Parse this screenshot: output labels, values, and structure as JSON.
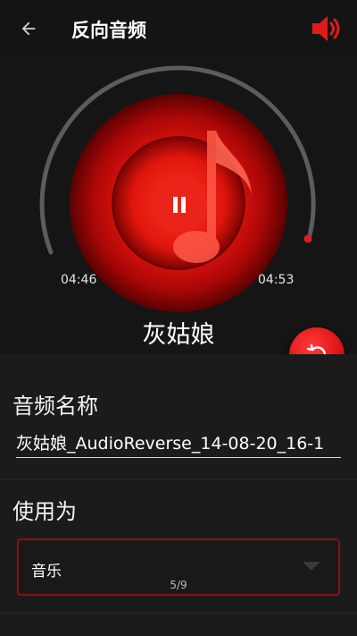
{
  "header": {
    "title": "反向音频",
    "back_icon": "arrow-left-icon",
    "volume_icon": "speaker-volume-icon",
    "accent": "#e11a1a"
  },
  "player": {
    "song_title": "灰姑娘",
    "elapsed": "04:46",
    "total": "04:53",
    "progress": 0.976,
    "pause_icon": "pause-icon",
    "reset_icon": "reverse-replay-icon"
  },
  "form": {
    "name_label": "音频名称",
    "name_value": "灰姑娘_AudioReverse_14-08-20_16-1",
    "use_label": "使用为",
    "use_value": "音乐",
    "page_indicator": "5/9"
  }
}
